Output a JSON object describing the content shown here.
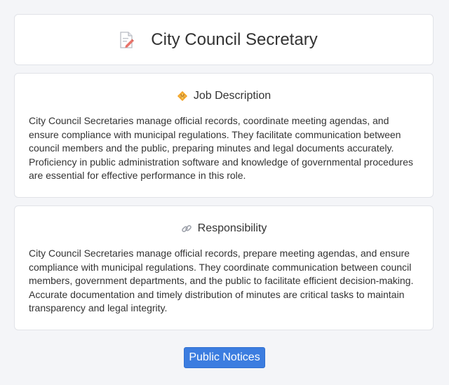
{
  "header": {
    "title": "City Council Secretary",
    "icon": "document-edit-icon"
  },
  "sections": {
    "job_description": {
      "title": "Job Description",
      "icon": "badge-icon",
      "text": "City Council Secretaries manage official records, coordinate meeting agendas, and ensure compliance with municipal regulations. They facilitate communication between council members and the public, preparing minutes and legal documents accurately. Proficiency in public administration software and knowledge of governmental procedures are essential for effective performance in this role."
    },
    "responsibility": {
      "title": "Responsibility",
      "icon": "link-icon",
      "text": "City Council Secretaries manage official records, prepare meeting agendas, and ensure compliance with municipal regulations. They coordinate communication between council members, government departments, and the public to facilitate efficient decision-making. Accurate documentation and timely distribution of minutes are critical tasks to maintain transparency and legal integrity."
    }
  },
  "actions": {
    "public_notices_label": "Public Notices"
  },
  "colors": {
    "accent": "#3c7de0",
    "background": "#f4f5f8",
    "card": "#ffffff"
  }
}
